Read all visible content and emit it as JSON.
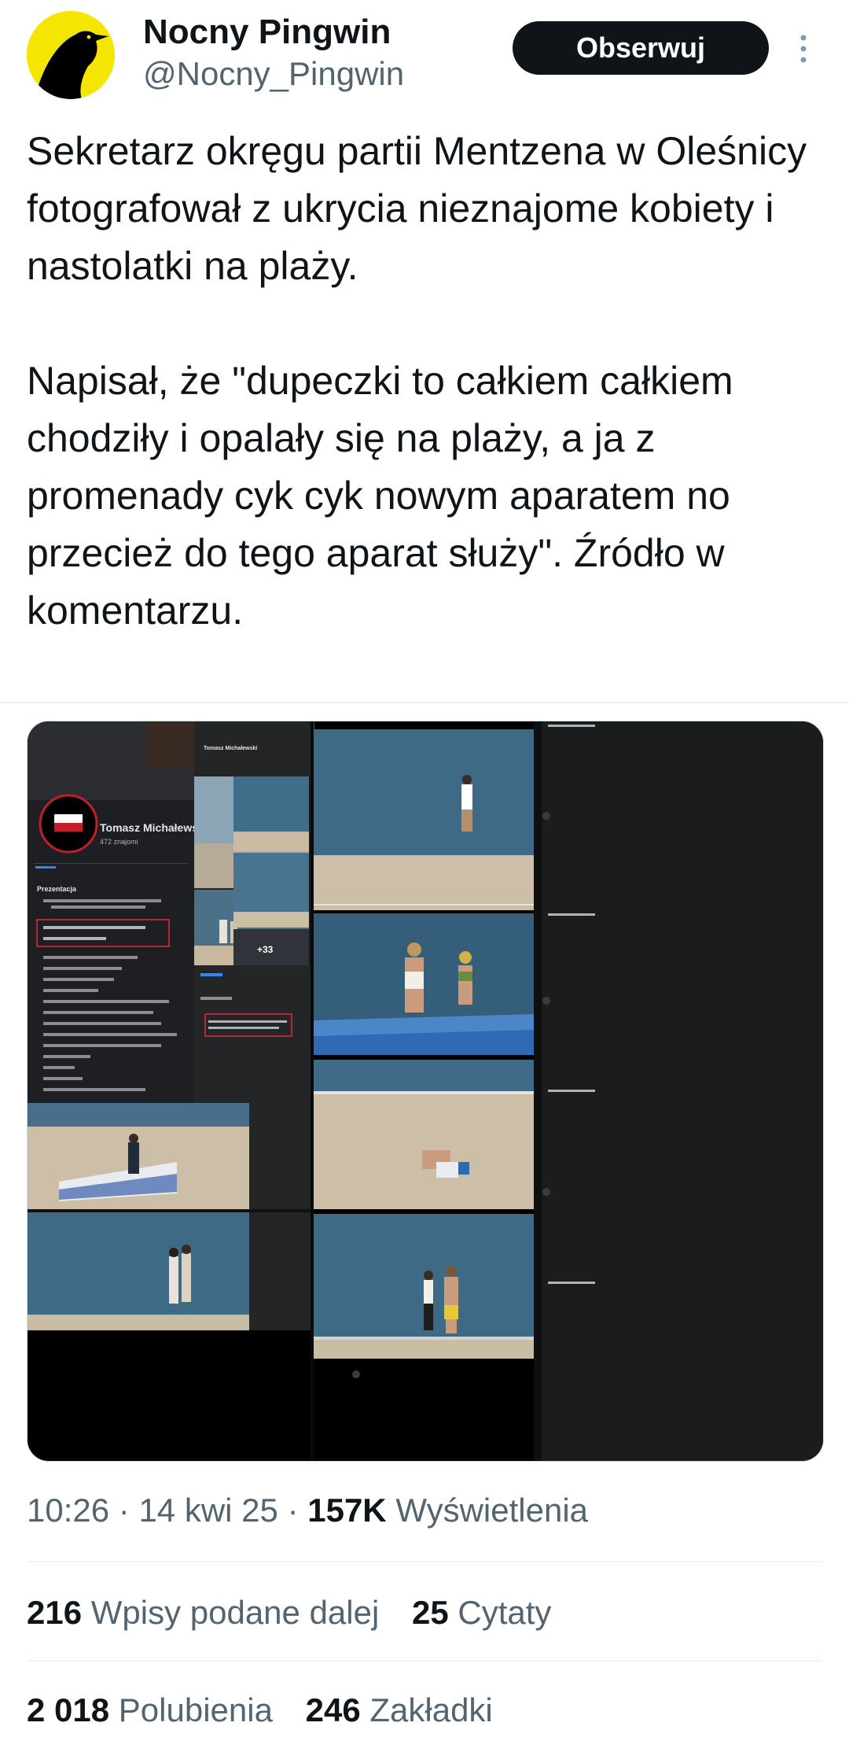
{
  "author": {
    "display_name": "Nocny Pingwin",
    "handle": "@Nocny_Pingwin",
    "avatar_icon": "black-bird-on-yellow-icon",
    "avatar_colors": {
      "background": "#f4e600",
      "bird": "#000000"
    }
  },
  "follow_button": {
    "label": "Obserwuj"
  },
  "more_icon": "more-vertical-icon",
  "tweet": {
    "paragraph_1": "Sekretarz okręgu partii Mentzena w Oleśnicy fotografował z ukrycia nieznajome kobiety i nastolatki na plaży.",
    "paragraph_2": "Napisał, że \"dupeczki to całkiem całkiem chodziły i opalały się na plaży, a ja z promenady cyk cyk nowym aparatem no przecież do tego aparat służy\". Źródło w komentarzu."
  },
  "media": {
    "screenshot_profile_name": "Tomasz Michałewski",
    "screenshot_followers": "472 znajomi",
    "screenshot_section": "Prezentacja",
    "screenshot_post_author": "Tomasz Michałewski",
    "screenshot_more_photos": "+33"
  },
  "meta": {
    "time": "10:26",
    "date": "14 kwi 25",
    "views_count": "157K",
    "views_label": "Wyświetlenia",
    "separator": "·"
  },
  "stats": {
    "reposts_count": "216",
    "reposts_label": "Wpisy podane dalej",
    "quotes_count": "25",
    "quotes_label": "Cytaty",
    "likes_count": "2 018",
    "likes_label": "Polubienia",
    "bookmarks_count": "246",
    "bookmarks_label": "Zakładki"
  },
  "colors": {
    "text_primary": "#0f1419",
    "text_secondary": "#536471",
    "divider": "#eff3f4",
    "sea": "#3e6a86",
    "sand": "#cdbfa7",
    "panel_dark": "#1e1f22"
  }
}
